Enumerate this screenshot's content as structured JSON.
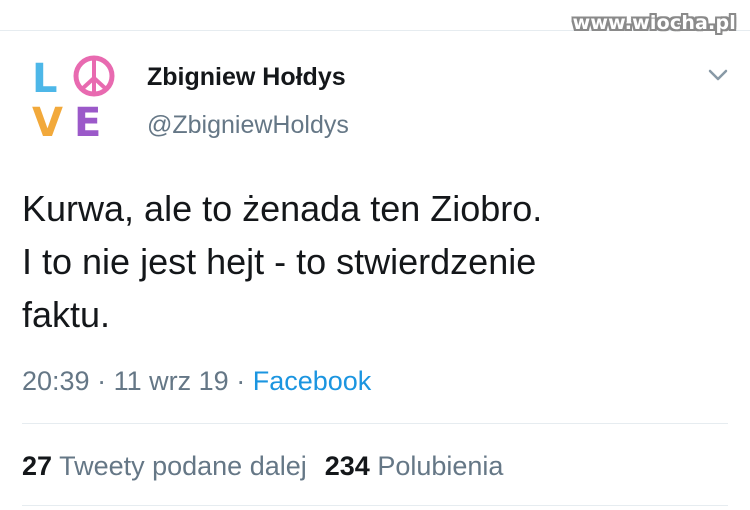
{
  "watermark": "www.wiocha.pl",
  "avatar": {
    "letters": [
      "L",
      "V",
      "E"
    ],
    "icon": "peace-symbol-icon"
  },
  "author": {
    "display_name": "Zbigniew Hołdys",
    "handle": "@ZbigniewHoldys"
  },
  "menu_icon": "chevron-down-icon",
  "tweet": {
    "lines": [
      "Kurwa, ale to żenada ten Ziobro.",
      "I to nie jest hejt - to stwierdzenie",
      "faktu."
    ]
  },
  "meta": {
    "time": "20:39",
    "separator": "·",
    "date": "11 wrz 19",
    "source": "Facebook"
  },
  "stats": {
    "retweets_count": "27",
    "retweets_label": "Tweety podane dalej",
    "likes_count": "234",
    "likes_label": "Polubienia"
  },
  "colors": {
    "text": "#14171a",
    "secondary": "#657786",
    "link": "#1b95e0",
    "divider": "#e6ecf0"
  }
}
